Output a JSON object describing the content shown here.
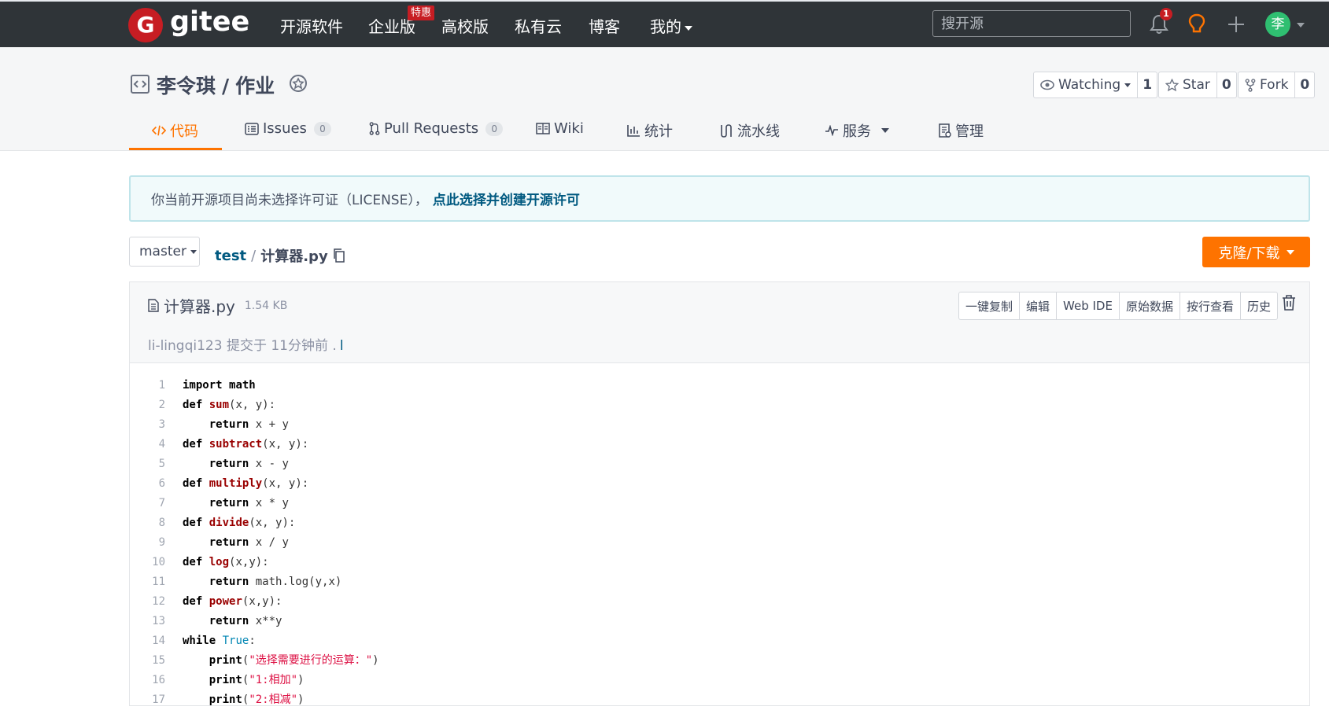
{
  "topbar": {
    "logo_letter": "G",
    "logo_text": "gitee",
    "nav": [
      "开源软件",
      "企业版",
      "高校版",
      "私有云",
      "博客",
      "我的"
    ],
    "special_badge": "特惠",
    "search_placeholder": "搜开源",
    "notification_count": "1",
    "avatar_initial": "李"
  },
  "repo": {
    "owner": "李令琪",
    "separator": "/",
    "name": "作业",
    "watch": {
      "label": "Watching",
      "count": "1"
    },
    "star": {
      "label": "Star",
      "count": "0"
    },
    "fork": {
      "label": "Fork",
      "count": "0"
    }
  },
  "tabs": [
    {
      "label": "代码",
      "icon": "code-icon"
    },
    {
      "label": "Issues",
      "count": "0",
      "icon": "issues-icon"
    },
    {
      "label": "Pull Requests",
      "count": "0",
      "icon": "pull-request-icon"
    },
    {
      "label": "Wiki",
      "icon": "wiki-icon"
    },
    {
      "label": "统计",
      "icon": "stats-icon"
    },
    {
      "label": "流水线",
      "icon": "pipeline-icon"
    },
    {
      "label": "服务",
      "icon": "service-icon"
    },
    {
      "label": "管理",
      "icon": "manage-icon"
    }
  ],
  "notice": {
    "text": "你当前开源项目尚未选择许可证（LICENSE），",
    "link": "点此选择并创建开源许可"
  },
  "branch": "master",
  "breadcrumb": {
    "dir": "test",
    "sep": "/",
    "file": "计算器.py"
  },
  "clone_label": "克隆/下载",
  "file": {
    "name": "计算器.py",
    "size": "1.54 KB",
    "actions": [
      "一键复制",
      "编辑",
      "Web IDE",
      "原始数据",
      "按行查看",
      "历史"
    ],
    "commit": "li-lingqi123 提交于 11分钟前 .",
    "commit_bar": "l"
  },
  "code": [
    {
      "n": "1",
      "parts": [
        [
          "kw",
          "import"
        ],
        [
          "src",
          " "
        ],
        [
          "kw",
          "math"
        ]
      ]
    },
    {
      "n": "2",
      "parts": [
        [
          "kw",
          "def"
        ],
        [
          "src",
          " "
        ],
        [
          "fn",
          "sum"
        ],
        [
          "src",
          "(x, y):"
        ]
      ]
    },
    {
      "n": "3",
      "parts": [
        [
          "src",
          "    "
        ],
        [
          "kw",
          "return"
        ],
        [
          "src",
          " x + y"
        ]
      ]
    },
    {
      "n": "4",
      "parts": [
        [
          "kw",
          "def"
        ],
        [
          "src",
          " "
        ],
        [
          "fn",
          "subtract"
        ],
        [
          "src",
          "(x, y):"
        ]
      ]
    },
    {
      "n": "5",
      "parts": [
        [
          "src",
          "    "
        ],
        [
          "kw",
          "return"
        ],
        [
          "src",
          " x - y"
        ]
      ]
    },
    {
      "n": "6",
      "parts": [
        [
          "kw",
          "def"
        ],
        [
          "src",
          " "
        ],
        [
          "fn",
          "multiply"
        ],
        [
          "src",
          "(x, y):"
        ]
      ]
    },
    {
      "n": "7",
      "parts": [
        [
          "src",
          "    "
        ],
        [
          "kw",
          "return"
        ],
        [
          "src",
          " x * y"
        ]
      ]
    },
    {
      "n": "8",
      "parts": [
        [
          "kw",
          "def"
        ],
        [
          "src",
          " "
        ],
        [
          "fn",
          "divide"
        ],
        [
          "src",
          "(x, y):"
        ]
      ]
    },
    {
      "n": "9",
      "parts": [
        [
          "src",
          "    "
        ],
        [
          "kw",
          "return"
        ],
        [
          "src",
          " x / y"
        ]
      ]
    },
    {
      "n": "10",
      "parts": [
        [
          "kw",
          "def"
        ],
        [
          "src",
          " "
        ],
        [
          "fn",
          "log"
        ],
        [
          "src",
          "(x,y):"
        ]
      ]
    },
    {
      "n": "11",
      "parts": [
        [
          "src",
          "    "
        ],
        [
          "kw",
          "return"
        ],
        [
          "src",
          " math.log(y,x)"
        ]
      ]
    },
    {
      "n": "12",
      "parts": [
        [
          "kw",
          "def"
        ],
        [
          "src",
          " "
        ],
        [
          "fn",
          "power"
        ],
        [
          "src",
          "(x,y):"
        ]
      ]
    },
    {
      "n": "13",
      "parts": [
        [
          "src",
          "    "
        ],
        [
          "kw",
          "return"
        ],
        [
          "src",
          " x**y"
        ]
      ]
    },
    {
      "n": "14",
      "parts": [
        [
          "kw",
          "while"
        ],
        [
          "src",
          " "
        ],
        [
          "bi",
          "True"
        ],
        [
          "src",
          ":"
        ]
      ]
    },
    {
      "n": "15",
      "parts": [
        [
          "src",
          "    "
        ],
        [
          "kw",
          "print"
        ],
        [
          "src",
          "("
        ],
        [
          "str",
          "\"选择需要进行的运算：\""
        ],
        [
          "src",
          ")"
        ]
      ]
    },
    {
      "n": "16",
      "parts": [
        [
          "src",
          "    "
        ],
        [
          "kw",
          "print"
        ],
        [
          "src",
          "("
        ],
        [
          "str",
          "\"1:相加\""
        ],
        [
          "src",
          ")"
        ]
      ]
    },
    {
      "n": "17",
      "parts": [
        [
          "src",
          "    "
        ],
        [
          "kw",
          "print"
        ],
        [
          "src",
          "("
        ],
        [
          "str",
          "\"2:相减\""
        ],
        [
          "src",
          ")"
        ]
      ]
    }
  ],
  "colors": {
    "accent": "#fe7300",
    "brand_red": "#c71d23",
    "link": "#005980",
    "topbar": "#2f3438"
  }
}
